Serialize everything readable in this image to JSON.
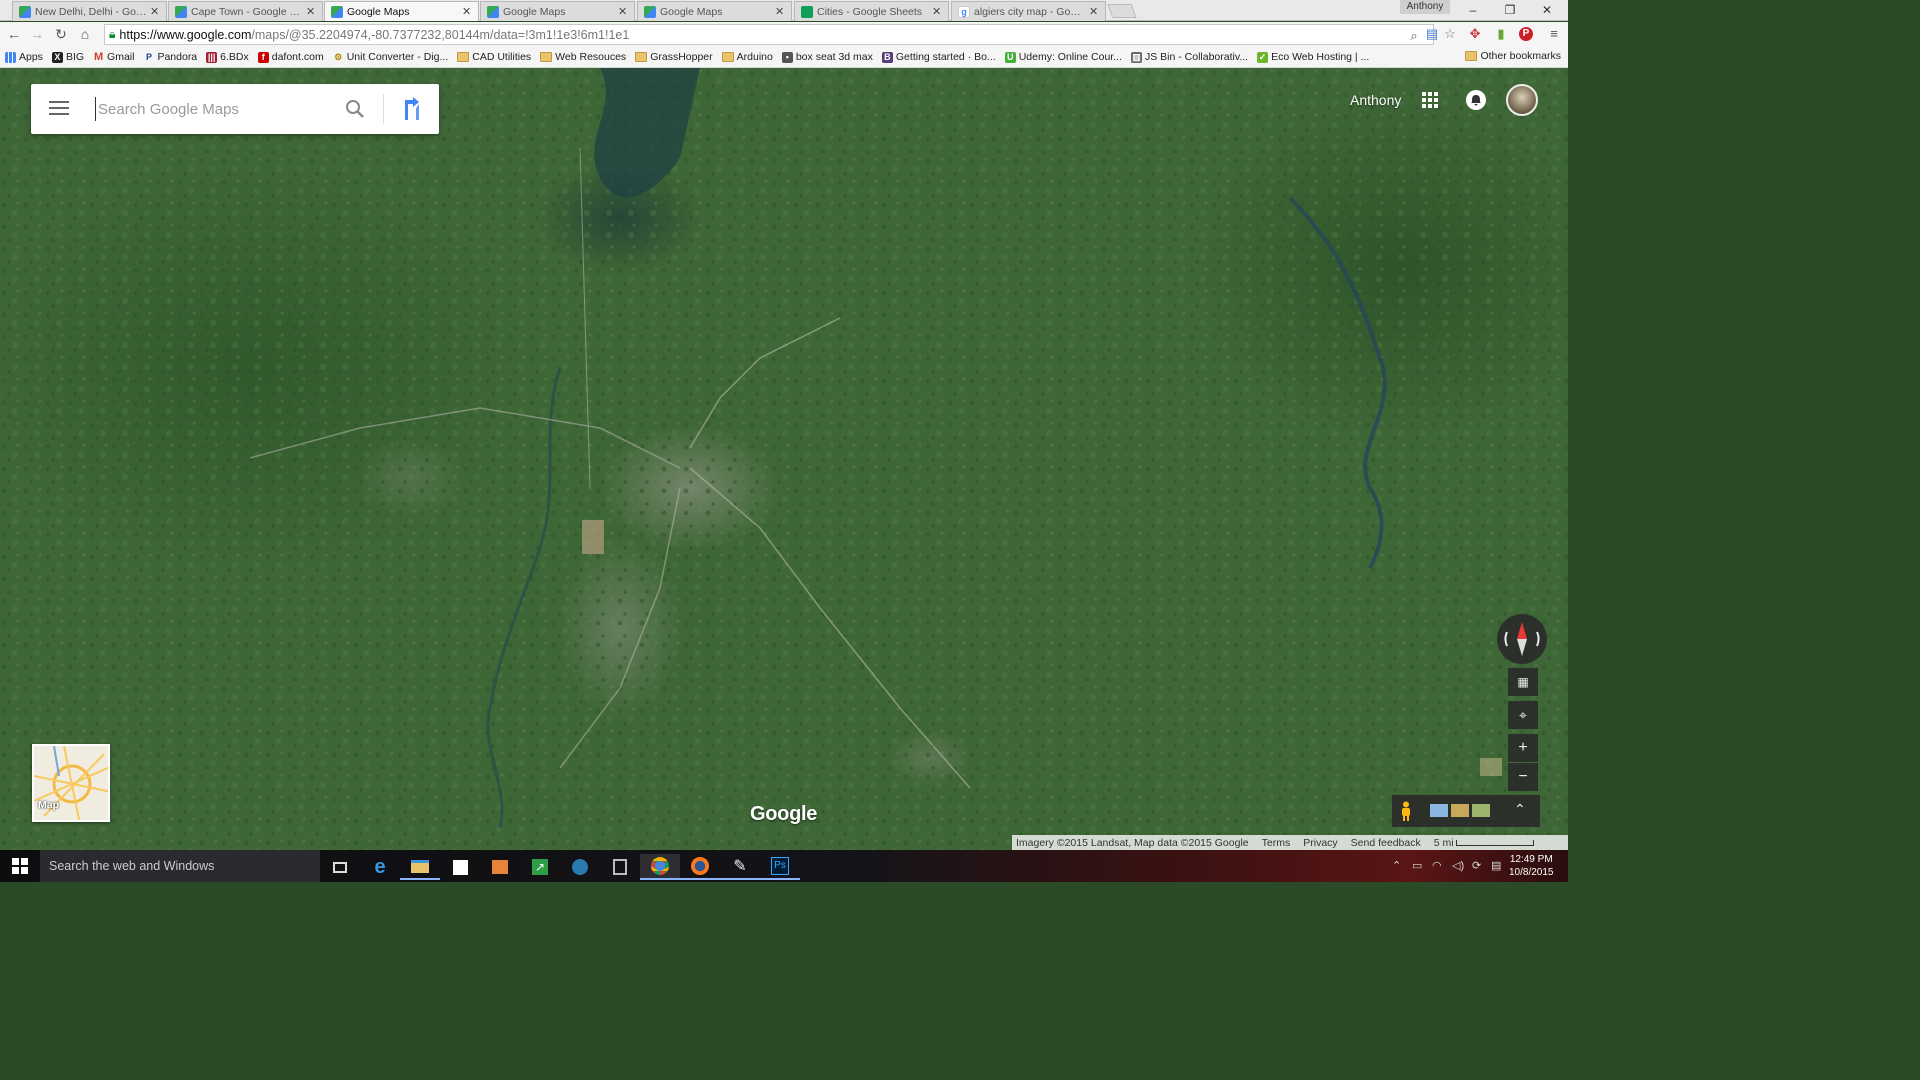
{
  "browser": {
    "tabs": [
      {
        "label": "New Delhi, Delhi - Google",
        "icon": "google-maps-icon",
        "active": false
      },
      {
        "label": "Cape Town - Google Map",
        "icon": "google-maps-icon",
        "active": false
      },
      {
        "label": "Google Maps",
        "icon": "google-maps-icon",
        "active": true
      },
      {
        "label": "Google Maps",
        "icon": "google-maps-icon",
        "active": false
      },
      {
        "label": "Google Maps",
        "icon": "google-maps-icon",
        "active": false
      },
      {
        "label": "Cities - Google Sheets",
        "icon": "google-sheets-icon",
        "active": false
      },
      {
        "label": "algiers city map - Google",
        "icon": "google-g-icon",
        "active": false
      }
    ],
    "profile_name": "Anthony",
    "url_host": "https://www.google.com",
    "url_path": "/maps/@35.2204974,-80.7377232,80144m/data=!3m1!1e3!6m1!1e1",
    "bookmarks": [
      {
        "label": "Apps",
        "icon": "apps-grid-icon"
      },
      {
        "label": "BIG",
        "icon": "big-icon"
      },
      {
        "label": "Gmail",
        "icon": "gmail-icon"
      },
      {
        "label": "Pandora",
        "icon": "pandora-icon"
      },
      {
        "label": "6.BDx",
        "icon": "edx-icon"
      },
      {
        "label": "dafont.com",
        "icon": "dafont-icon"
      },
      {
        "label": "Unit Converter - Dig...",
        "icon": "converter-icon"
      },
      {
        "label": "CAD Utilities",
        "icon": "folder-icon"
      },
      {
        "label": "Web Resouces",
        "icon": "folder-icon"
      },
      {
        "label": "GrassHopper",
        "icon": "folder-icon"
      },
      {
        "label": "Arduino",
        "icon": "folder-icon"
      },
      {
        "label": "box seat 3d max",
        "icon": "page-icon"
      },
      {
        "label": "Getting started · Bo...",
        "icon": "bootstrap-icon"
      },
      {
        "label": "Udemy: Online Cour...",
        "icon": "udemy-icon"
      },
      {
        "label": "JS Bin - Collaborativ...",
        "icon": "jsbin-icon"
      },
      {
        "label": "Eco Web Hosting | ...",
        "icon": "eco-icon"
      }
    ],
    "other_bookmarks": "Other bookmarks"
  },
  "maps": {
    "search_placeholder": "Search Google Maps",
    "account_name": "Anthony",
    "minimap_label": "Map",
    "logo": "Google",
    "footer": {
      "imagery": "Imagery ©2015 Landsat, Map data ©2015 Google",
      "terms": "Terms",
      "privacy": "Privacy",
      "feedback": "Send feedback",
      "scale": "5 mi"
    }
  },
  "taskbar": {
    "search_placeholder": "Search the web and Windows",
    "apps": [
      "task-view-icon",
      "edge-icon",
      "file-explorer-icon",
      "store-icon",
      "media-player-icon",
      "stocks-icon",
      "network-app-icon",
      "unknown-app-icon",
      "chrome-icon",
      "firefox-icon",
      "pen-app-icon",
      "photoshop-icon"
    ],
    "time": "12:49 PM",
    "date": "10/8/2015"
  },
  "colors": {
    "map_green": "#3f6636",
    "tab_active": "#f7f7f7",
    "photoshop": "#001d34"
  }
}
